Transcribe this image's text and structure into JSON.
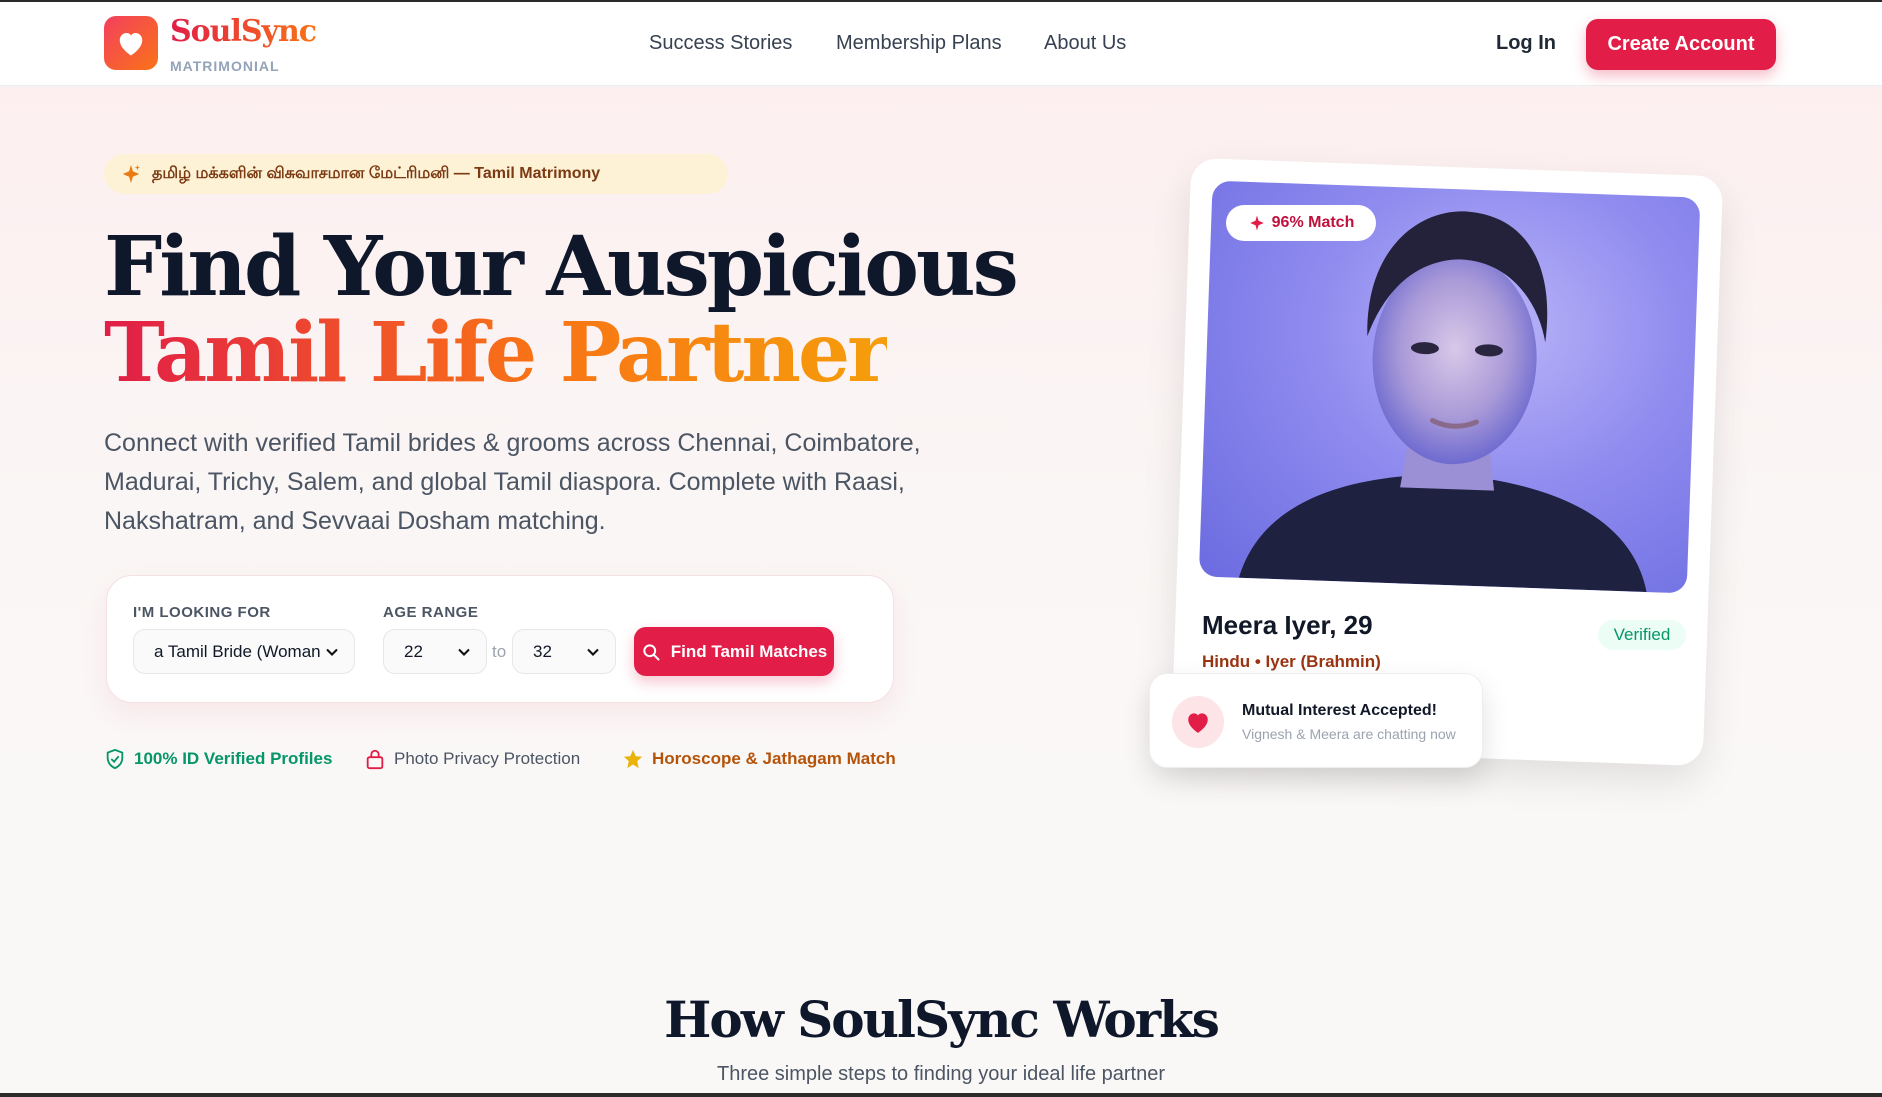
{
  "brand": {
    "name": "SoulSync",
    "subtitle": "MATRIMONIAL"
  },
  "nav": {
    "links": [
      "Success Stories",
      "Membership Plans",
      "About Us"
    ],
    "login": "Log In",
    "create_account": "Create Account"
  },
  "hero": {
    "tag": "தமிழ் மக்களின் விசுவாசமான மேட்ரிமனி — Tamil Matrimony",
    "title_line1": "Find Your Auspicious",
    "title_line2": "Tamil Life Partner",
    "lead": "Connect with verified Tamil brides & grooms across Chennai, Coimbatore, Madurai, Trichy, Salem, and global Tamil diaspora. Complete with Raasi, Nakshatram, and Sevvaai Dosham matching."
  },
  "search": {
    "looking_for_label": "I'M LOOKING FOR",
    "looking_for_value": "a Tamil Bride (Woman",
    "age_label": "AGE RANGE",
    "age_min": "22",
    "age_to": "to",
    "age_max": "32",
    "button": "Find Tamil Matches"
  },
  "trust": [
    {
      "label": "100% ID Verified Profiles",
      "color": "#059669",
      "icon": "shield-check-icon"
    },
    {
      "label": "Photo Privacy Protection",
      "color": "#4b5563",
      "icon": "lock-icon"
    },
    {
      "label": "Horoscope & Jathagam Match",
      "color": "#b45309",
      "icon": "star-icon"
    }
  ],
  "profile": {
    "match": "96% Match",
    "name": "Meera Iyer, 29",
    "verified": "Verified",
    "caste": "Hindu • Iyer (Brahmin)"
  },
  "toast": {
    "title": "Mutual Interest Accepted!",
    "subtitle": "Vignesh & Meera are chatting now"
  },
  "how": {
    "title": "How SoulSync Works",
    "subtitle": "Three simple steps to finding your ideal life partner"
  },
  "colors": {
    "accent": "#e11d48",
    "accent2": "#f97316",
    "success": "#059669"
  }
}
